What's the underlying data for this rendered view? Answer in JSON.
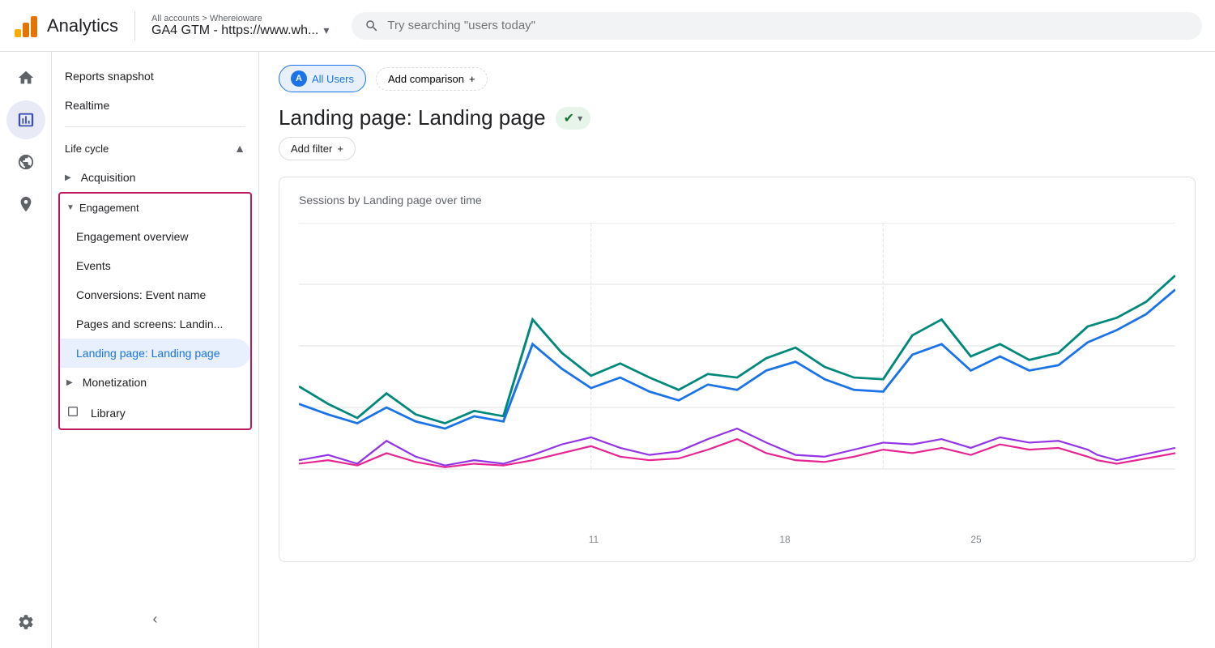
{
  "topbar": {
    "logo_alt": "Google Analytics Logo",
    "title": "Analytics",
    "breadcrumb": "All accounts > Whereioware",
    "property": "GA4 GTM - https://www.wh...",
    "search_placeholder": "Try searching \"users today\""
  },
  "icon_sidebar": {
    "items": [
      {
        "name": "home-icon",
        "symbol": "⌂",
        "active": false
      },
      {
        "name": "reports-icon",
        "symbol": "📊",
        "active": true
      },
      {
        "name": "explore-icon",
        "symbol": "◎",
        "active": false
      },
      {
        "name": "advertising-icon",
        "symbol": "⊕",
        "active": false
      }
    ],
    "bottom": [
      {
        "name": "settings-icon",
        "symbol": "⚙",
        "active": false
      }
    ]
  },
  "nav": {
    "reports_snapshot": "Reports snapshot",
    "realtime": "Realtime",
    "lifecycle_label": "Life cycle",
    "acquisition_label": "Acquisition",
    "engagement_label": "Engagement",
    "engagement_sub": [
      {
        "label": "Engagement overview",
        "active": false
      },
      {
        "label": "Events",
        "active": false
      },
      {
        "label": "Conversions: Event name",
        "active": false
      },
      {
        "label": "Pages and screens: Landin...",
        "active": false
      },
      {
        "label": "Landing page: Landing page",
        "active": true
      }
    ],
    "monetization_label": "Monetization",
    "library_label": "Library",
    "collapse_label": "Collapse"
  },
  "content": {
    "all_users_chip": "All Users",
    "add_comparison_btn": "Add comparison",
    "page_title": "Landing page: Landing page",
    "add_filter_btn": "Add filter",
    "chart_title": "Sessions by Landing page over time",
    "x_axis_labels": [
      "11",
      "18",
      "25"
    ]
  },
  "chart": {
    "gridlines": 5,
    "series": [
      {
        "name": "teal-series",
        "color": "#00897b",
        "points": [
          160,
          120,
          90,
          140,
          75,
          60,
          110,
          70,
          290,
          190,
          130,
          160,
          110,
          85,
          140,
          120,
          180,
          210,
          155,
          120,
          100,
          240,
          290,
          185,
          220,
          170,
          190,
          280,
          310,
          350
        ]
      },
      {
        "name": "blue-series",
        "color": "#1a73e8",
        "points": [
          120,
          90,
          70,
          100,
          60,
          50,
          80,
          60,
          200,
          140,
          100,
          120,
          90,
          70,
          110,
          95,
          140,
          165,
          120,
          95,
          80,
          185,
          220,
          145,
          175,
          135,
          150,
          220,
          245,
          275
        ]
      },
      {
        "name": "purple-series",
        "color": "#9334e6",
        "points": [
          20,
          30,
          15,
          50,
          25,
          10,
          20,
          15,
          30,
          45,
          60,
          40,
          30,
          35,
          55,
          70,
          45,
          30,
          25,
          35,
          50,
          45,
          55,
          40,
          60,
          50,
          45,
          35,
          30,
          40
        ]
      },
      {
        "name": "pink-series",
        "color": "#e52592",
        "points": [
          10,
          20,
          10,
          30,
          15,
          8,
          12,
          10,
          20,
          30,
          40,
          25,
          20,
          22,
          35,
          45,
          30,
          20,
          18,
          25,
          35,
          30,
          38,
          28,
          42,
          35,
          32,
          25,
          22,
          28
        ]
      }
    ]
  }
}
